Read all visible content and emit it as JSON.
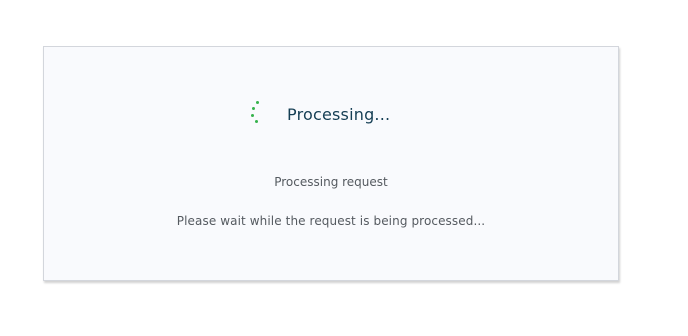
{
  "dialog": {
    "title": "Processing...",
    "status": "Processing request",
    "message": "Please wait while the request is being processed...",
    "spinner_icon": "loading-spinner-icon",
    "accent_color": "#37b24d",
    "title_color": "#153e54"
  }
}
